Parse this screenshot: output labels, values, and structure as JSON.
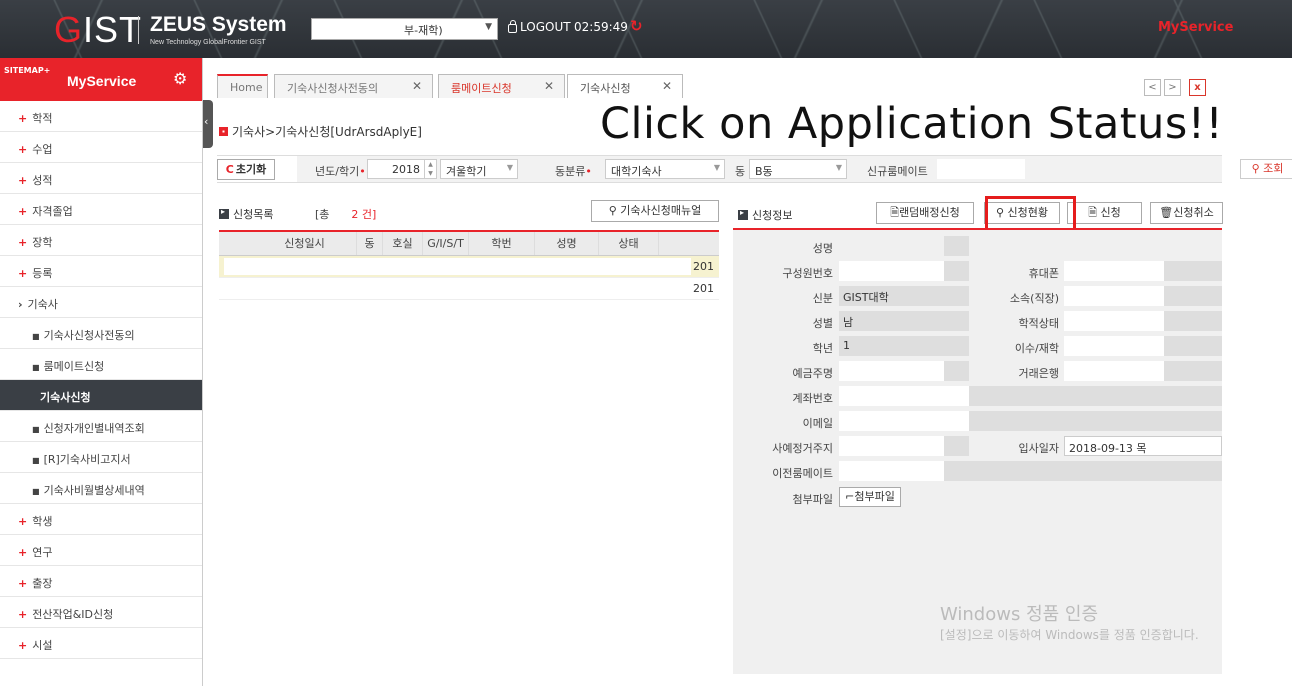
{
  "header": {
    "logo_g": "G",
    "logo_rest": "IST",
    "system_title": "ZEUS System",
    "system_subtitle": "New Technology GlobalFrontier GIST",
    "role_select": "부-재학)",
    "logout_label": "LOGOUT",
    "timer": "02:59:49",
    "my_service": "MyService"
  },
  "sidebar": {
    "sitemap": "SITEMAP+",
    "title": "MyService",
    "items": [
      {
        "label": "학적",
        "type": "plus"
      },
      {
        "label": "수업",
        "type": "plus"
      },
      {
        "label": "성적",
        "type": "plus"
      },
      {
        "label": "자격졸업",
        "type": "plus"
      },
      {
        "label": "장학",
        "type": "plus"
      },
      {
        "label": "등록",
        "type": "plus"
      },
      {
        "label": "기숙사",
        "type": "open"
      },
      {
        "label": "기숙사신청사전동의",
        "type": "sub"
      },
      {
        "label": "룸메이트신청",
        "type": "sub"
      },
      {
        "label": "기숙사신청",
        "type": "sub-active"
      },
      {
        "label": "신청자개인별내역조회",
        "type": "sub"
      },
      {
        "label": "[R]기숙사비고지서",
        "type": "sub"
      },
      {
        "label": "기숙사비월별상세내역",
        "type": "sub"
      },
      {
        "label": "학생",
        "type": "plus"
      },
      {
        "label": "연구",
        "type": "plus"
      },
      {
        "label": "출장",
        "type": "plus"
      },
      {
        "label": "전산작업&ID신청",
        "type": "plus"
      },
      {
        "label": "시설",
        "type": "plus"
      }
    ]
  },
  "tabs": {
    "home": "Home",
    "tab1": "기숙사신청사전동의",
    "tab2": "룸메이트신청",
    "tab3": "기숙사신청",
    "prev": "<",
    "next": ">",
    "close": "x"
  },
  "page": {
    "breadcrumb": "기숙사>기숙사신청[UdrArsdAplyE]",
    "overlay_text": "Click on Application Status!!"
  },
  "search": {
    "reset": "초기화",
    "year_label": "년도/학기",
    "year": "2018",
    "term": "겨울학기",
    "category_label": "동분류",
    "category": "대학기숙사",
    "building_label": "동",
    "building": "B동",
    "roommate_label": "신규룸메이트",
    "query": "조회"
  },
  "list": {
    "title": "신청목록",
    "count_prefix": "[총",
    "count_value": "2 건]",
    "manual_button": "기숙사신청매뉴얼",
    "columns": [
      "신청일시",
      "동",
      "호실",
      "G/I/S/T",
      "학번",
      "성명",
      "상태"
    ],
    "rows": [
      {
        "tail": "201"
      },
      {
        "tail": "201"
      }
    ]
  },
  "info": {
    "title": "신청정보",
    "buttons": {
      "random": "랜덤배정신청",
      "status": "신청현황",
      "apply": "신청",
      "cancel": "신청취소"
    },
    "fields": {
      "name": "성명",
      "member_no": "구성원번호",
      "phone": "휴대폰",
      "status_label": "신분",
      "status_value": "GIST대학",
      "affiliation": "소속(직장)",
      "gender_label": "성별",
      "gender_value": "남",
      "academic_status": "학적상태",
      "grade_label": "학년",
      "grade_value": "1",
      "completion": "이수/재학",
      "depositor": "예금주명",
      "bank": "거래은행",
      "account": "계좌번호",
      "email": "이메일",
      "prev_address": "사예정거주지",
      "move_in_label": "입사일자",
      "move_in_value": "2018-09-13 목",
      "prev_roommate": "이전룸메이트",
      "attachment_label": "첨부파일",
      "attachment_button": "첨부파일"
    }
  },
  "watermark": {
    "line1": "Windows 정품 인증",
    "line2": "[설정]으로 이동하여 Windows를 정품 인증합니다."
  }
}
